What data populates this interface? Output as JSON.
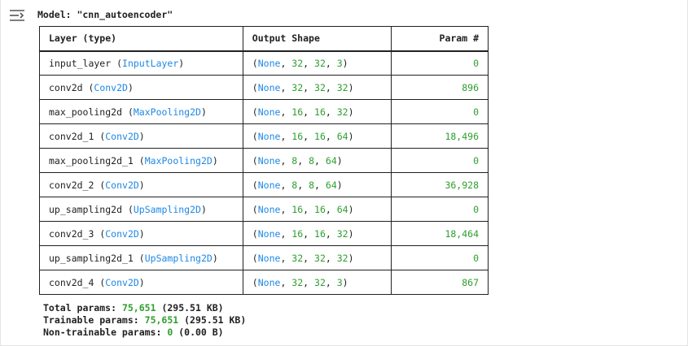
{
  "model": {
    "title": "Model: \"cnn_autoencoder\""
  },
  "table": {
    "headers": [
      "Layer (type)",
      "Output Shape",
      "Param #"
    ],
    "rows": [
      {
        "name": "input_layer",
        "type": "InputLayer",
        "shape": [
          "None",
          "32",
          "32",
          "3"
        ],
        "params": "0"
      },
      {
        "name": "conv2d",
        "type": "Conv2D",
        "shape": [
          "None",
          "32",
          "32",
          "32"
        ],
        "params": "896"
      },
      {
        "name": "max_pooling2d",
        "type": "MaxPooling2D",
        "shape": [
          "None",
          "16",
          "16",
          "32"
        ],
        "params": "0"
      },
      {
        "name": "conv2d_1",
        "type": "Conv2D",
        "shape": [
          "None",
          "16",
          "16",
          "64"
        ],
        "params": "18,496"
      },
      {
        "name": "max_pooling2d_1",
        "type": "MaxPooling2D",
        "shape": [
          "None",
          "8",
          "8",
          "64"
        ],
        "params": "0"
      },
      {
        "name": "conv2d_2",
        "type": "Conv2D",
        "shape": [
          "None",
          "8",
          "8",
          "64"
        ],
        "params": "36,928"
      },
      {
        "name": "up_sampling2d",
        "type": "UpSampling2D",
        "shape": [
          "None",
          "16",
          "16",
          "64"
        ],
        "params": "0"
      },
      {
        "name": "conv2d_3",
        "type": "Conv2D",
        "shape": [
          "None",
          "16",
          "16",
          "32"
        ],
        "params": "18,464"
      },
      {
        "name": "up_sampling2d_1",
        "type": "UpSampling2D",
        "shape": [
          "None",
          "32",
          "32",
          "32"
        ],
        "params": "0"
      },
      {
        "name": "conv2d_4",
        "type": "Conv2D",
        "shape": [
          "None",
          "32",
          "32",
          "3"
        ],
        "params": "867"
      }
    ]
  },
  "totals": {
    "total_label": "Total params:",
    "total_value": "75,651",
    "total_size": "(295.51 KB)",
    "trainable_label": "Trainable params:",
    "trainable_value": "75,651",
    "trainable_size": "(295.51 KB)",
    "nontrainable_label": "Non-trainable params:",
    "nontrainable_value": "0",
    "nontrainable_size": "(0.00 B)"
  },
  "icons": {
    "gutter": "output-collapse-icon"
  },
  "colors": {
    "type_blue": "#1e88e5",
    "number_green": "#2e9e2e",
    "text": "#212121"
  }
}
